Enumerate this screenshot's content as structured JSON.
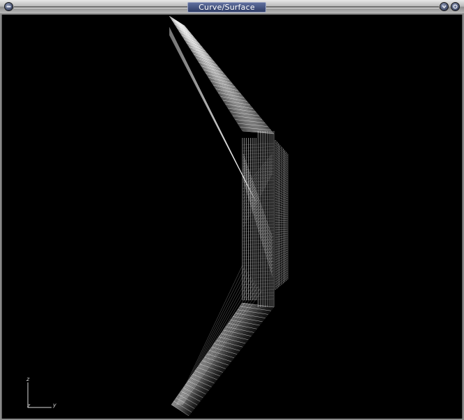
{
  "window": {
    "title": "Curve/Surface"
  },
  "titlebar": {
    "menu_icon": "window-menu-icon",
    "minimize_icon": "minimize-icon",
    "close_icon": "close-icon"
  },
  "viewport": {
    "background": "#000000",
    "wireframe_color": "#ffffff",
    "axes": {
      "z_label": "z",
      "origin_label": "z",
      "y_label": "y"
    }
  }
}
